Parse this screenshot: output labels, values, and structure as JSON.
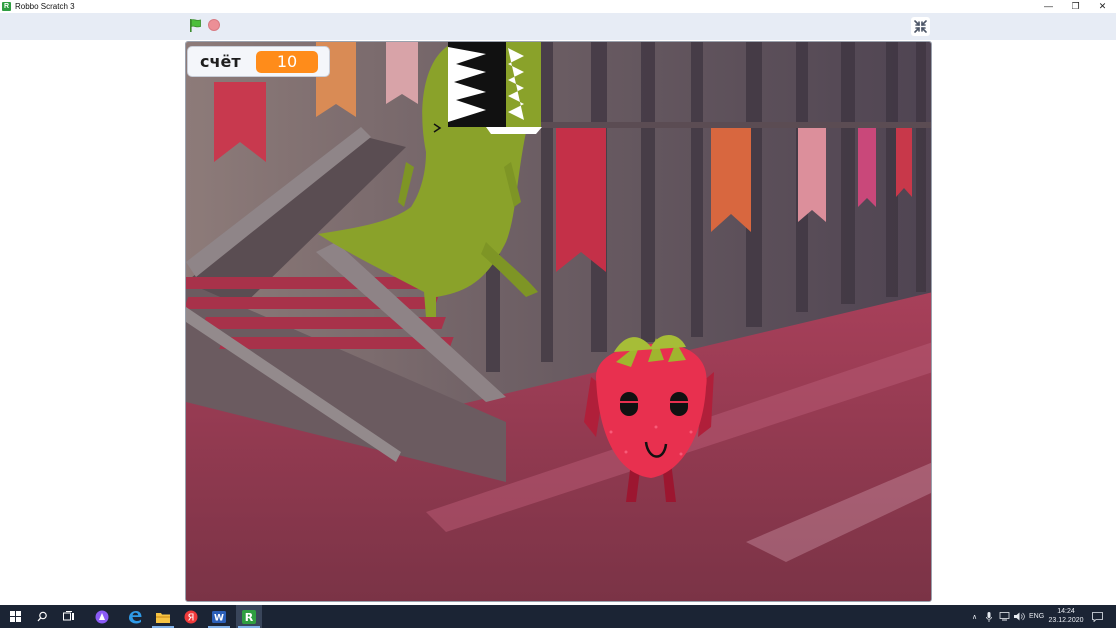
{
  "window": {
    "title": "Robbo Scratch 3",
    "app_icon_letter": "R",
    "controls": [
      "minimize-icon",
      "restore-icon",
      "close-icon"
    ],
    "control_glyphs": [
      "—",
      "❐",
      "✕"
    ]
  },
  "toolbar": {
    "green_flag_icon": "green-flag-icon",
    "stop_icon": "stop-icon",
    "fullscreen_icon": "exit-fullscreen-icon"
  },
  "stage": {
    "monitor": {
      "label": "счёт",
      "value": "10"
    },
    "sprites": [
      "dinosaur",
      "strawberry"
    ],
    "backdrop": "castle-hall"
  },
  "taskbar": {
    "items": [
      {
        "icon": "windows-start-icon"
      },
      {
        "icon": "search-icon"
      },
      {
        "icon": "task-view-icon"
      },
      {
        "icon": "alice-assistant-icon"
      },
      {
        "icon": "edge-browser-icon"
      },
      {
        "icon": "file-explorer-icon"
      },
      {
        "icon": "yandex-browser-icon",
        "letter": "Я"
      },
      {
        "icon": "word-icon",
        "letter": "W"
      },
      {
        "icon": "robbo-scratch-icon",
        "letter": "R"
      }
    ],
    "tray": {
      "language": "ENG",
      "time": "14:24",
      "date": "23.12.2020"
    }
  },
  "colors": {
    "toolbar_bg": "#e7ecf5",
    "monitor_value_bg": "#ff8c1a",
    "taskbar_bg": "#1b2434",
    "dino_green": "#8aa22a",
    "strawberry_red": "#e8304f"
  }
}
